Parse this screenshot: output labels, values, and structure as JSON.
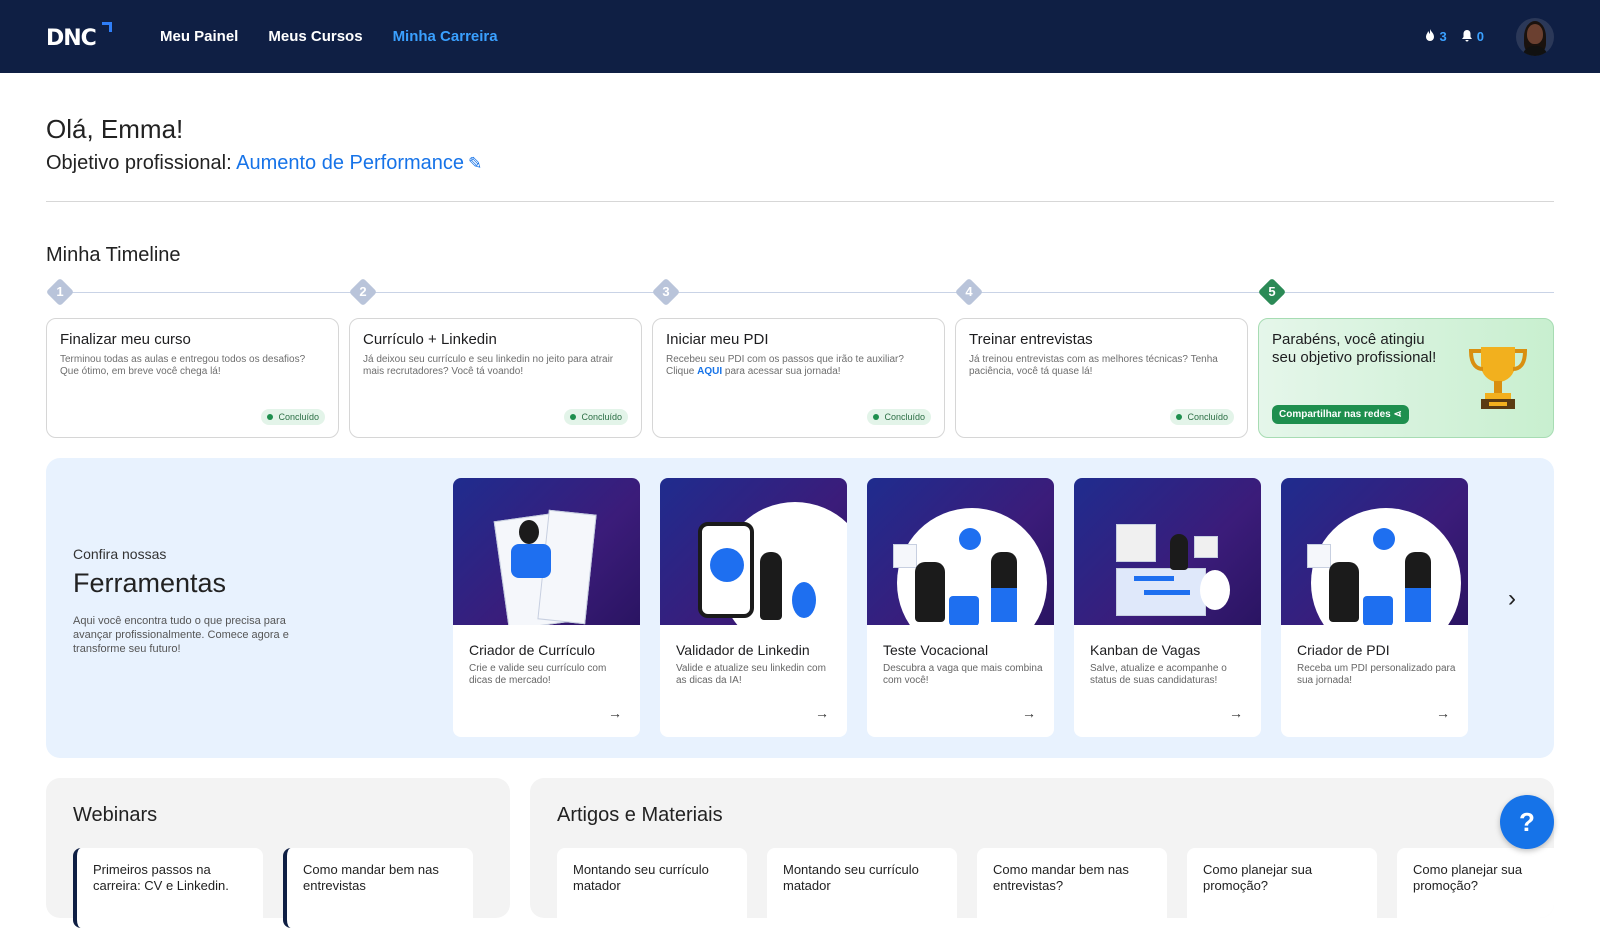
{
  "header": {
    "logo_text": "DNC",
    "nav": [
      "Meu Painel",
      "Meus Cursos",
      "Minha Carreira"
    ],
    "active_nav": "Minha Carreira",
    "streak_count": "3",
    "notifications_count": "0"
  },
  "greeting": {
    "hello": "Olá, Emma!",
    "objective_label": "Objetivo profissional: ",
    "objective_value": "Aumento de Performance"
  },
  "timeline": {
    "title": "Minha Timeline",
    "steps": [
      {
        "num": "1",
        "title": "Finalizar meu curso",
        "desc": "Terminou todas as aulas e entregou todos os desafios? Que ótimo, em breve você chega lá!",
        "status": "Concluído"
      },
      {
        "num": "2",
        "title": "Currículo + Linkedin",
        "desc": "Já deixou seu currículo e seu linkedin no jeito para atrair mais recrutadores? Você tá voando!",
        "status": "Concluído"
      },
      {
        "num": "3",
        "title": "Iniciar meu PDI",
        "desc_pre": "Recebeu seu PDI com os passos que irão te auxiliar? Clique ",
        "desc_link": "AQUI",
        "desc_post": " para acessar sua jornada!",
        "status": "Concluído"
      },
      {
        "num": "4",
        "title": "Treinar entrevistas",
        "desc": "Já treinou entrevistas com as melhores técnicas? Tenha paciência, você tá quase lá!",
        "status": "Concluído"
      },
      {
        "num": "5",
        "title": "Parabéns, você atingiu seu objetivo profissional!",
        "share": "Compartilhar nas redes"
      }
    ]
  },
  "tools": {
    "pre": "Confira nossas",
    "title": "Ferramentas",
    "desc": "Aqui você encontra tudo o que precisa para avançar profissionalmente. Comece agora e transforme seu futuro!",
    "cards": [
      {
        "title": "Criador de Currículo",
        "desc": "Crie e valide seu currículo com dicas de mercado!"
      },
      {
        "title": "Validador de Linkedin",
        "desc": "Valide e atualize seu linkedin com as dicas da IA!"
      },
      {
        "title": "Teste Vocacional",
        "desc": "Descubra a vaga que mais combina com você!"
      },
      {
        "title": "Kanban de Vagas",
        "desc": "Salve, atualize e acompanhe o status de suas candidaturas!"
      },
      {
        "title": "Criador de PDI",
        "desc": "Receba um PDI personalizado para sua jornada!"
      }
    ]
  },
  "webinars": {
    "title": "Webinars",
    "items": [
      "Primeiros passos na carreira: CV e Linkedin.",
      "Como mandar bem nas entrevistas"
    ]
  },
  "articles": {
    "title": "Artigos e Materiais",
    "items": [
      "Montando seu currículo matador",
      "Montando seu currículo matador",
      "Como mandar bem nas entrevistas?",
      "Como planejar sua promoção?",
      "Como planejar sua promoção?"
    ]
  },
  "help_label": "?"
}
